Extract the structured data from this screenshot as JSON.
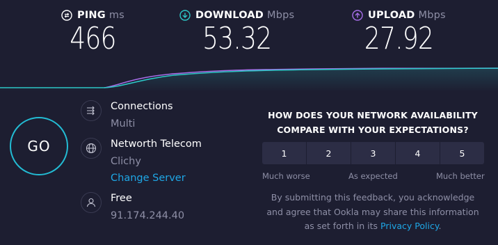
{
  "metrics": {
    "ping": {
      "label": "PING",
      "unit": "ms",
      "value": "466"
    },
    "download": {
      "label": "DOWNLOAD",
      "unit": "Mbps",
      "value": "53.32"
    },
    "upload": {
      "label": "UPLOAD",
      "unit": "Mbps",
      "value": "27.92"
    }
  },
  "colors": {
    "accent": "#1ea7e6",
    "download_line": "#2dc6c6",
    "upload_line": "#a66ee8",
    "background": "#1d1e31"
  },
  "connections": {
    "title": "Connections",
    "value": "Multi"
  },
  "server": {
    "name": "Networth Telecom",
    "location": "Clichy",
    "change_label": "Change Server"
  },
  "isp": {
    "name": "Free",
    "ip": "91.174.244.40"
  },
  "go_label": "GO",
  "survey": {
    "question_line1": "HOW DOES YOUR NETWORK AVAILABILITY",
    "question_line2": "COMPARE WITH YOUR EXPECTATIONS?",
    "options": [
      "1",
      "2",
      "3",
      "4",
      "5"
    ],
    "scale_low": "Much worse",
    "scale_mid": "As expected",
    "scale_high": "Much better",
    "consent_line1": "By submitting this feedback, you acknowledge",
    "consent_line2": "and agree that Ookla may share this information",
    "consent_line3": "as set forth in its",
    "privacy_link": "Privacy Policy",
    "consent_end": "."
  }
}
